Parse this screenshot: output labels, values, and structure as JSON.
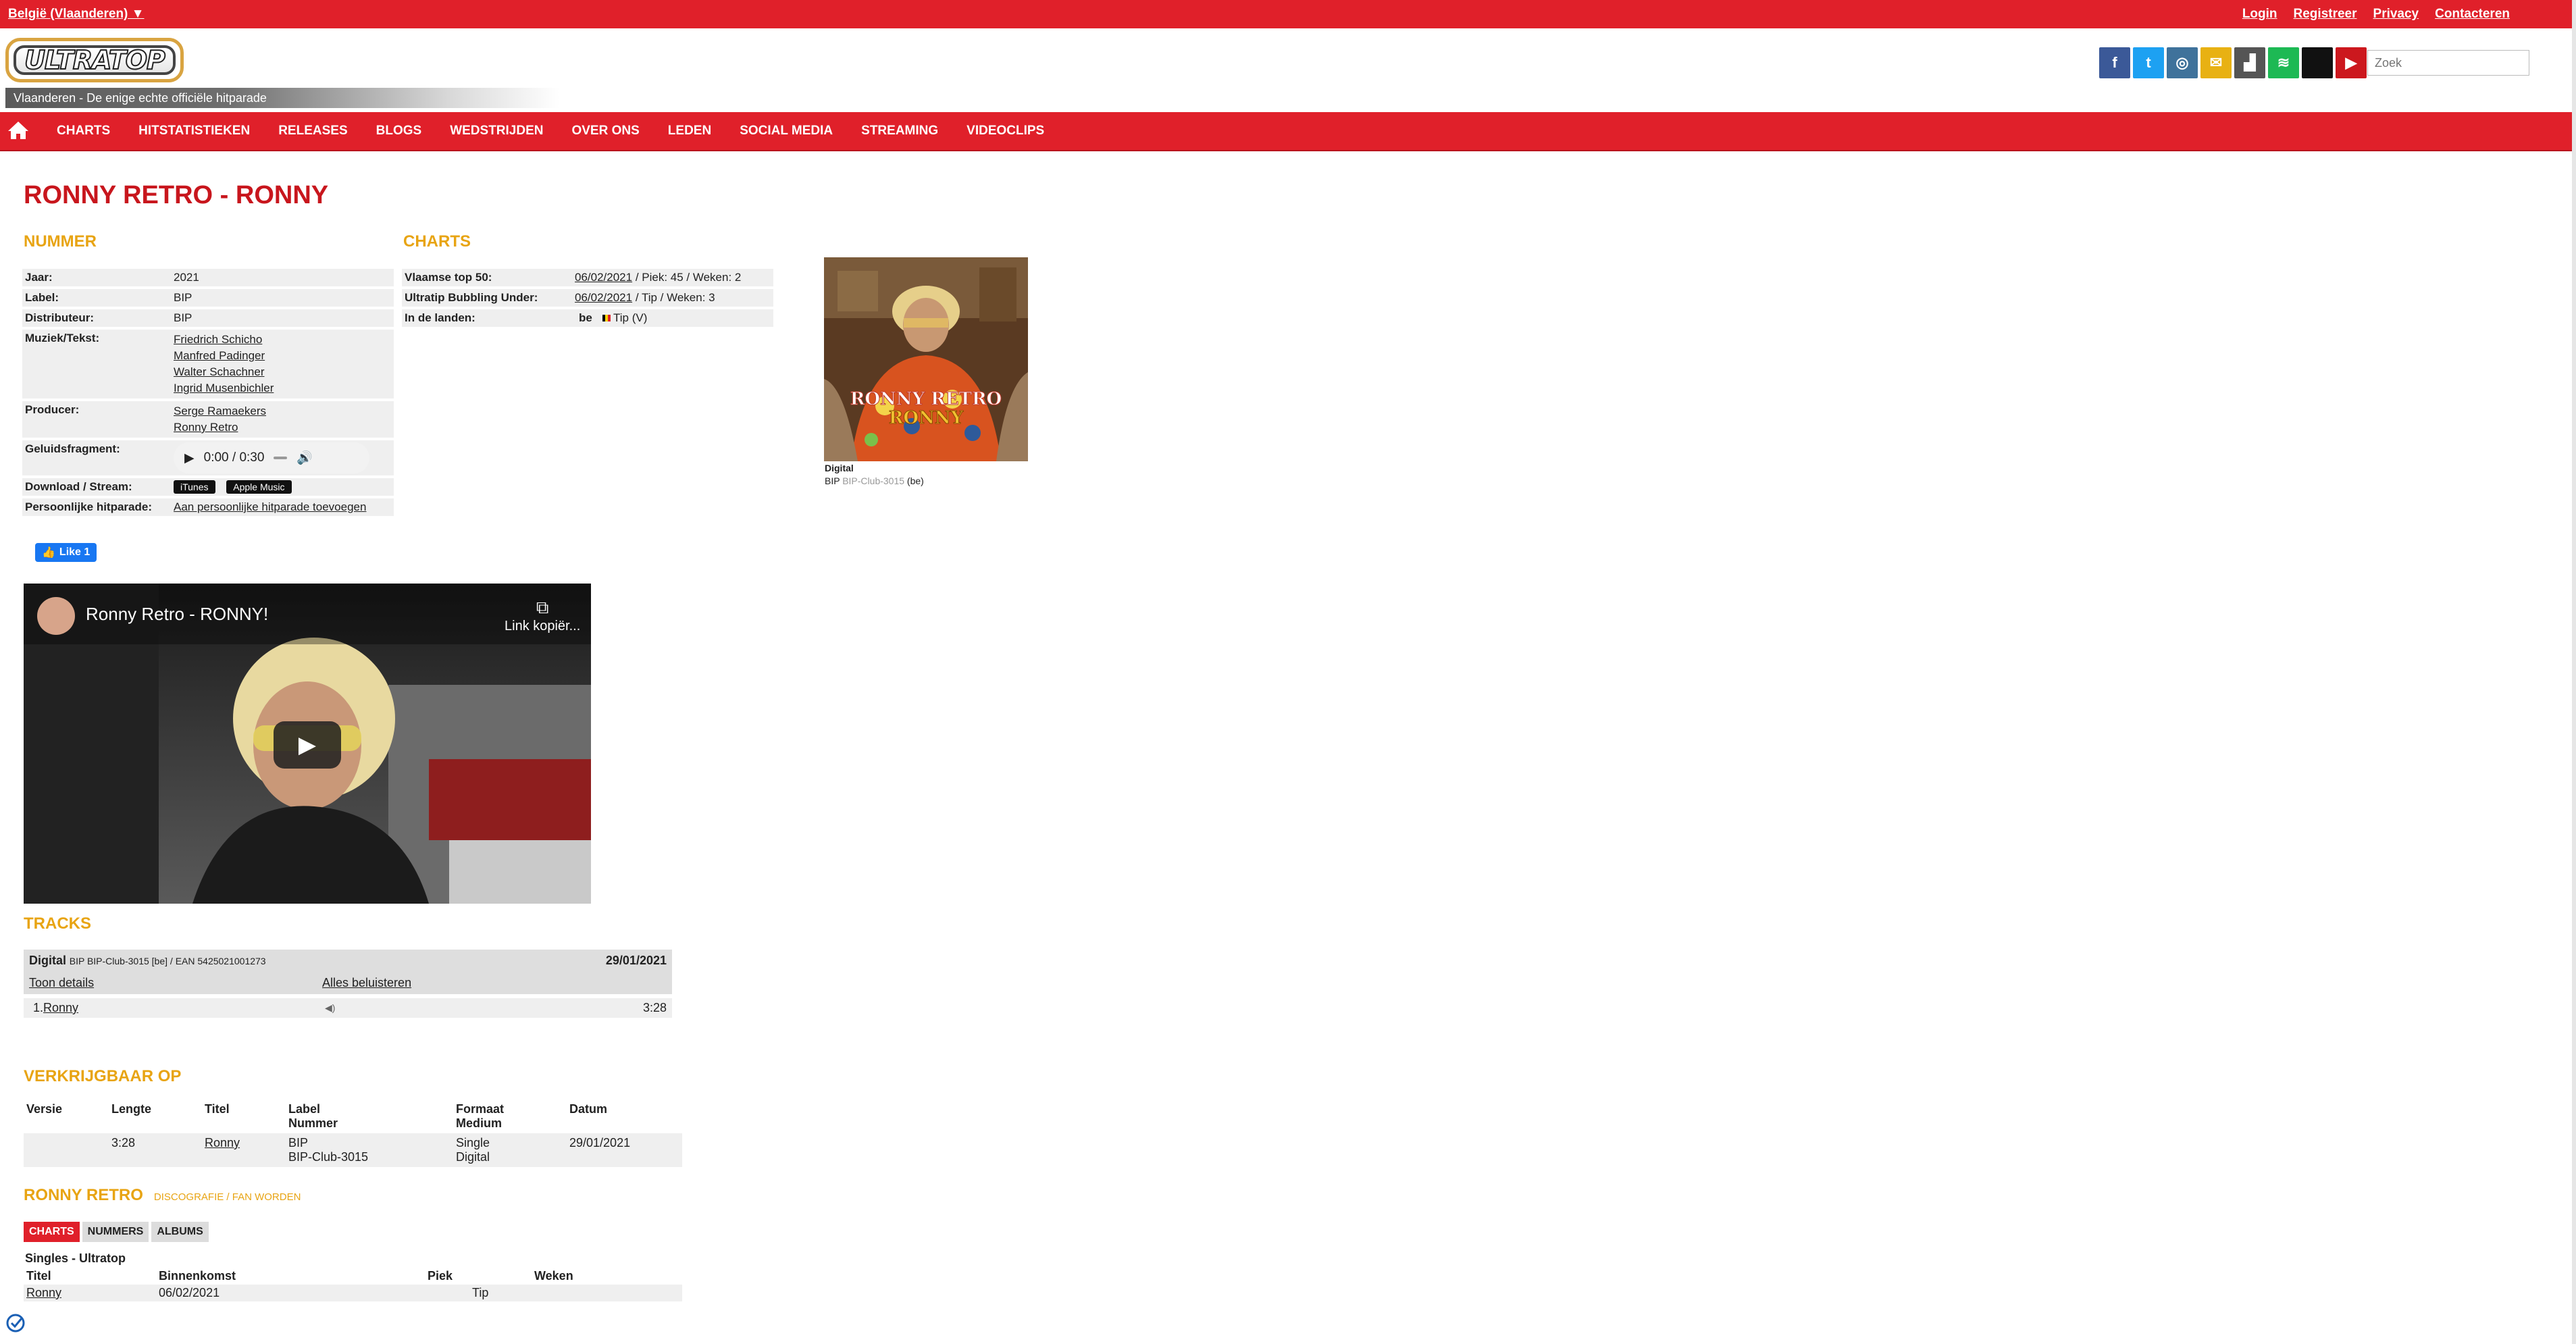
{
  "topbar": {
    "country": "België (Vlaanderen) ▼",
    "links": [
      "Login",
      "Registreer",
      "Privacy",
      "Contacteren"
    ]
  },
  "header": {
    "logo_text": "ULTRATOP",
    "tagline": "Vlaanderen - De enige echte officiële hitparade",
    "search_placeholder": "Zoek",
    "social": [
      {
        "name": "facebook-icon",
        "glyph": "f",
        "color": "#3b5998"
      },
      {
        "name": "twitter-icon",
        "glyph": "t",
        "color": "#1da1f2"
      },
      {
        "name": "instagram-icon",
        "glyph": "◎",
        "color": "#3f729b"
      },
      {
        "name": "mail-icon",
        "glyph": "✉",
        "color": "#e8b113"
      },
      {
        "name": "stats-icon",
        "glyph": "▟",
        "color": "#555555"
      },
      {
        "name": "spotify-icon",
        "glyph": "≋",
        "color": "#1db954"
      },
      {
        "name": "apple-music-icon",
        "glyph": "",
        "color": "#111111"
      },
      {
        "name": "youtube-icon",
        "glyph": "▶",
        "color": "#cc181e"
      }
    ]
  },
  "nav": {
    "items": [
      "CHARTS",
      "HITSTATISTIEKEN",
      "RELEASES",
      "BLOGS",
      "WEDSTRIJDEN",
      "OVER ONS",
      "LEDEN",
      "SOCIAL MEDIA",
      "STREAMING",
      "VIDEOCLIPS"
    ]
  },
  "page_title": "RONNY RETRO - RONNY",
  "song": {
    "section_title": "NUMMER",
    "year_label": "Jaar:",
    "year": "2021",
    "label_label": "Label:",
    "label": "BIP",
    "distributor_label": "Distributeur:",
    "distributor": "BIP",
    "writers_label": "Muziek/Tekst:",
    "writers": [
      "Friedrich Schicho",
      "Manfred Padinger",
      "Walter Schachner",
      "Ingrid Musenbichler"
    ],
    "producer_label": "Producer:",
    "producers": [
      "Serge Ramaekers",
      "Ronny Retro"
    ],
    "sound_label": "Geluidsfragment:",
    "audio_time": "0:00 / 0:30",
    "download_label": "Download / Stream:",
    "download_itunes": "iTunes",
    "download_apple": "Apple Music",
    "personal_label": "Persoonlijke hitparade:",
    "personal_link": "Aan persoonlijke hitparade toevoegen",
    "fb_like": "Like 1"
  },
  "charts": {
    "section_title": "CHARTS",
    "rows": [
      {
        "label": "Vlaamse top 50:",
        "date": "06/02/2021",
        "rest": " / Piek: 45 / Weken: 2"
      },
      {
        "label": "Ultratip Bubbling Under:",
        "date": "06/02/2021",
        "rest": " / Tip / Weken: 3"
      }
    ],
    "countries_label": "In de landen:",
    "country_code": "be",
    "country_value": "Tip (V)"
  },
  "cover": {
    "art_line1": "RONNY RETRO",
    "art_line2": "RONNY",
    "format": "Digital",
    "label": "BIP",
    "catalog": "BIP-Club-3015",
    "country": "(be)"
  },
  "video": {
    "title": "Ronny Retro - RONNY!",
    "copy_link": "Link kopiër..."
  },
  "tracks": {
    "section_title": "TRACKS",
    "format": "Digital",
    "meta": "BIP BIP-Club-3015 [be] / EAN 5425021001273",
    "date": "29/01/2021",
    "details_link": "Toon details",
    "listen_all": "Alles beluisteren",
    "items": [
      {
        "num": "1.",
        "title": "Ronny",
        "length": "3:28"
      }
    ]
  },
  "available": {
    "section_title": "VERKRIJGBAAR OP",
    "headers": [
      "Versie",
      "Lengte",
      "Titel",
      "Label\nNummer",
      "Formaat\nMedium",
      "Datum"
    ],
    "rows": [
      {
        "version": "",
        "length": "3:28",
        "title": "Ronny",
        "label": "BIP",
        "number": "BIP-Club-3015",
        "format": "Single",
        "medium": "Digital",
        "date": "29/01/2021"
      }
    ]
  },
  "artist": {
    "name": "RONNY RETRO",
    "link": "DISCOGRAFIE / FAN WORDEN",
    "tabs": [
      "CHARTS",
      "NUMMERS",
      "ALBUMS"
    ],
    "chart_title": "Singles - Ultratop",
    "headers": [
      "Titel",
      "Binnenkomst",
      "Piek",
      "Weken"
    ],
    "rows": [
      {
        "title": "Ronny",
        "entry": "06/02/2021",
        "peak": "Tip",
        "weeks": ""
      }
    ]
  },
  "colors": {
    "brand_red": "#e0202a",
    "section_orange": "#e8a413",
    "title_red": "#c8161d"
  }
}
